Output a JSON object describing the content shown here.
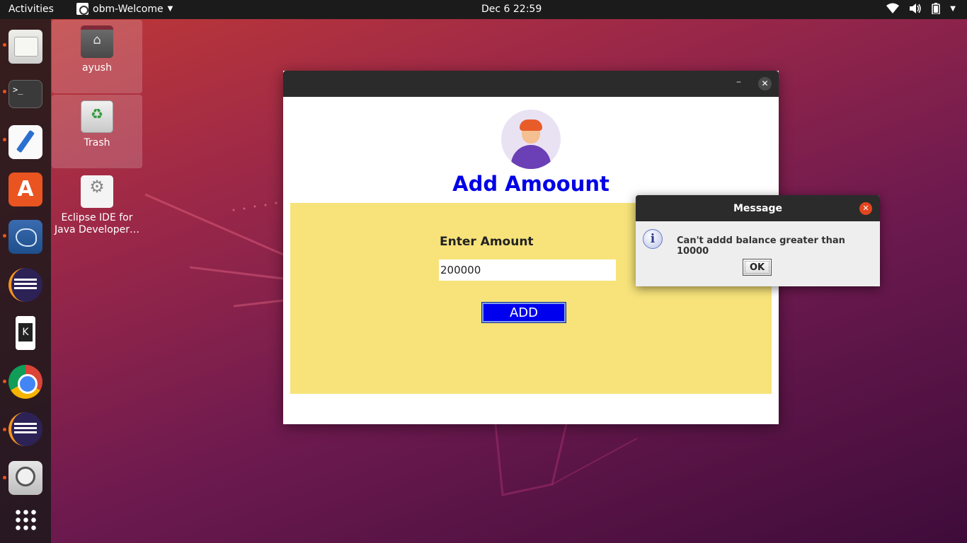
{
  "topbar": {
    "activities": "Activities",
    "app_name": "obm-Welcome",
    "clock": "Dec 6  22:59"
  },
  "dock": {
    "items": [
      "files",
      "terminal",
      "text-editor",
      "software",
      "mysql-workbench",
      "eclipse",
      "kde-connect",
      "chrome",
      "eclipse",
      "magnifier",
      "show-apps"
    ],
    "terminal_glyph": ">_"
  },
  "desktop": {
    "icons": [
      {
        "label": "ayush"
      },
      {
        "label": "Trash"
      },
      {
        "label": "Eclipse IDE for Java Developer…"
      }
    ]
  },
  "window": {
    "title": "Add Amoount",
    "amount_label": "Enter Amount",
    "amount_value": "200000",
    "add_button": "ADD",
    "min_glyph": "–",
    "close_glyph": "✕"
  },
  "dialog": {
    "title": "Message",
    "message": "Can't addd balance greater than 10000",
    "ok_button": "OK",
    "info_glyph": "i",
    "close_glyph": "✕"
  },
  "colors": {
    "title_blue": "#0000e6",
    "panel_yellow": "#f7e37a",
    "button_blue": "#0000ee",
    "ubuntu_orange": "#e95420"
  }
}
